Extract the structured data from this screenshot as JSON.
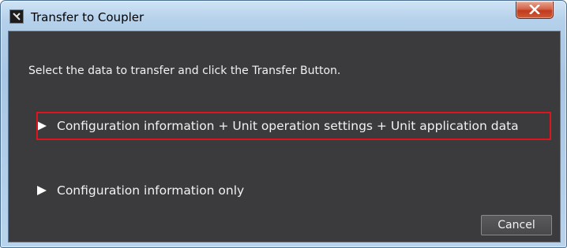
{
  "window": {
    "title": "Transfer to Coupler",
    "close_icon": "close-icon",
    "app_icon": "app-icon"
  },
  "dialog": {
    "instruction": "Select the data to transfer and click the Transfer Button.",
    "options": [
      {
        "label": "Configuration information + Unit operation settings + Unit application data",
        "icon": "expand-triangle-icon",
        "highlighted": true
      },
      {
        "label": "Configuration information only",
        "icon": "expand-triangle-icon",
        "highlighted": false
      }
    ],
    "cancel_label": "Cancel"
  },
  "colors": {
    "client_background": "#3b3b3d",
    "text": "#f2f2f2",
    "highlight_border": "#e0141c",
    "title_bar": "#b4d0ea",
    "close_button": "#c23a1e"
  }
}
